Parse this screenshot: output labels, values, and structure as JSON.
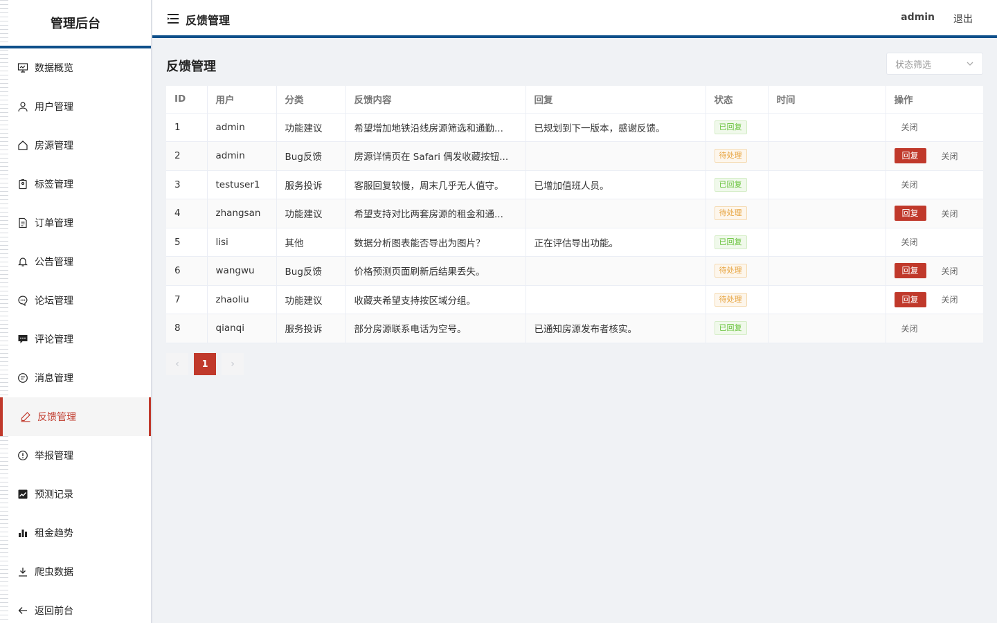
{
  "sidebar": {
    "brand": "管理后台",
    "items": [
      {
        "label": "数据概览",
        "icon": "presentation-icon"
      },
      {
        "label": "用户管理",
        "icon": "user-icon"
      },
      {
        "label": "房源管理",
        "icon": "home-icon"
      },
      {
        "label": "标签管理",
        "icon": "tag-icon"
      },
      {
        "label": "订单管理",
        "icon": "document-icon"
      },
      {
        "label": "公告管理",
        "icon": "bell-icon"
      },
      {
        "label": "论坛管理",
        "icon": "chat-dots-icon"
      },
      {
        "label": "评论管理",
        "icon": "comment-icon"
      },
      {
        "label": "消息管理",
        "icon": "message-icon"
      },
      {
        "label": "反馈管理",
        "icon": "edit-pen-icon",
        "active": true
      },
      {
        "label": "举报管理",
        "icon": "warning-circle-icon"
      },
      {
        "label": "预测记录",
        "icon": "line-chart-icon"
      },
      {
        "label": "租金趋势",
        "icon": "bar-chart-icon"
      },
      {
        "label": "爬虫数据",
        "icon": "download-icon"
      },
      {
        "label": "返回前台",
        "icon": "arrow-left-icon"
      }
    ]
  },
  "header": {
    "title": "反馈管理",
    "user": "admin",
    "logout": "退出"
  },
  "main": {
    "title": "反馈管理",
    "filter_placeholder": "状态筛选",
    "columns": [
      "ID",
      "用户",
      "分类",
      "反馈内容",
      "回复",
      "状态",
      "时间",
      "操作"
    ],
    "rows": [
      {
        "id": "1",
        "user": "admin",
        "category": "功能建议",
        "content": "希望增加地铁沿线房源筛选和通勤...",
        "reply": "已规划到下一版本，感谢反馈。",
        "status": "已回复",
        "time": "",
        "replied": true
      },
      {
        "id": "2",
        "user": "admin",
        "category": "Bug反馈",
        "content": "房源详情页在 Safari 偶发收藏按钮...",
        "reply": "",
        "status": "待处理",
        "time": "",
        "replied": false
      },
      {
        "id": "3",
        "user": "testuser1",
        "category": "服务投诉",
        "content": "客服回复较慢，周末几乎无人值守。",
        "reply": "已增加值班人员。",
        "status": "已回复",
        "time": "",
        "replied": true
      },
      {
        "id": "4",
        "user": "zhangsan",
        "category": "功能建议",
        "content": "希望支持对比两套房源的租金和通...",
        "reply": "",
        "status": "待处理",
        "time": "",
        "replied": false
      },
      {
        "id": "5",
        "user": "lisi",
        "category": "其他",
        "content": "数据分析图表能否导出为图片？",
        "reply": "正在评估导出功能。",
        "status": "已回复",
        "time": "",
        "replied": true
      },
      {
        "id": "6",
        "user": "wangwu",
        "category": "Bug反馈",
        "content": "价格预测页面刷新后结果丢失。",
        "reply": "",
        "status": "待处理",
        "time": "",
        "replied": false
      },
      {
        "id": "7",
        "user": "zhaoliu",
        "category": "功能建议",
        "content": "收藏夹希望支持按区域分组。",
        "reply": "",
        "status": "待处理",
        "time": "",
        "replied": false
      },
      {
        "id": "8",
        "user": "qianqi",
        "category": "服务投诉",
        "content": "部分房源联系电话为空号。",
        "reply": "已通知房源发布者核实。",
        "status": "已回复",
        "time": "",
        "replied": true
      }
    ],
    "actions": {
      "reply": "回复",
      "close": "关闭"
    },
    "pagination": {
      "prev": "‹",
      "current": "1",
      "next": "›"
    }
  },
  "colors": {
    "accent": "#c0392b",
    "header_border": "#0e4f8a",
    "success": "#67c23a",
    "warning": "#e6a23c"
  }
}
